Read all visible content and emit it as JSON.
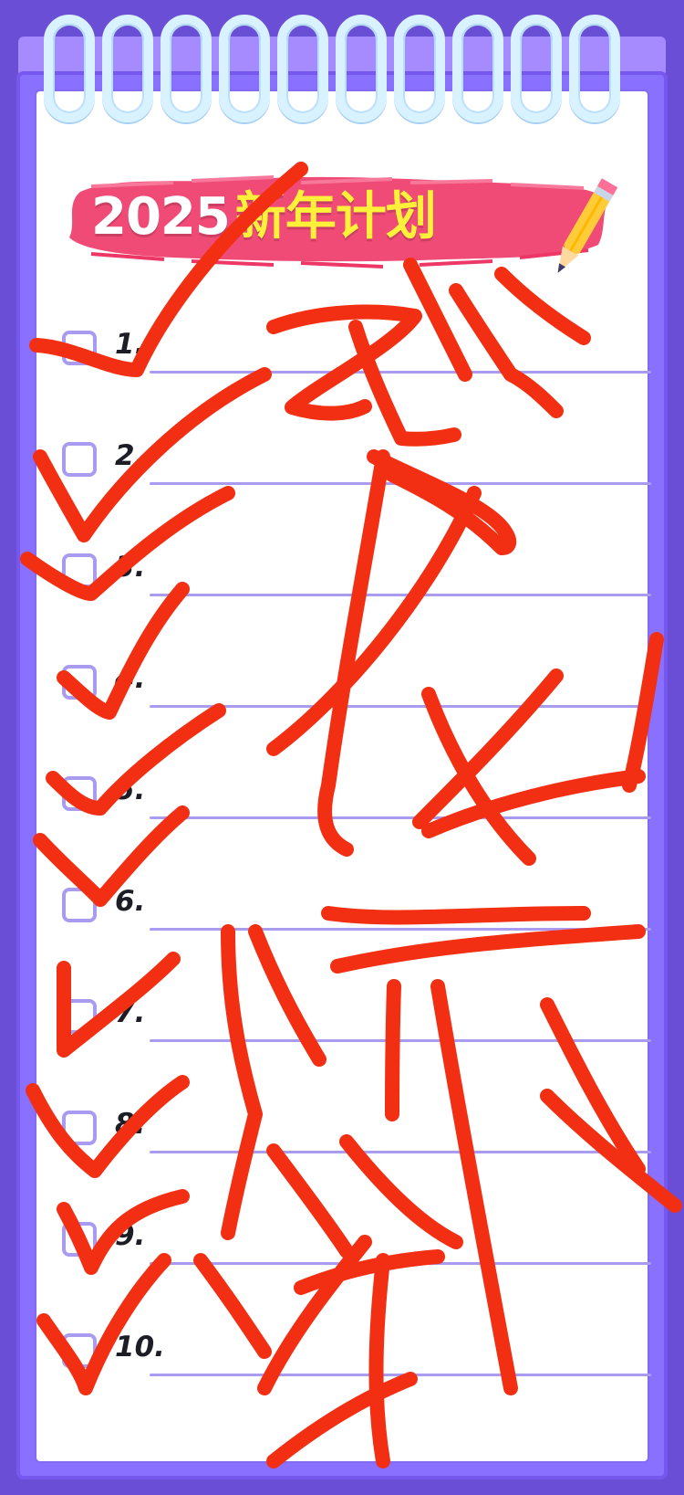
{
  "title": {
    "year": "2025",
    "plan_text": "新年计划"
  },
  "items": [
    {
      "number": "1."
    },
    {
      "number": "2."
    },
    {
      "number": "3."
    },
    {
      "number": "4."
    },
    {
      "number": "5."
    },
    {
      "number": "6."
    },
    {
      "number": "7."
    },
    {
      "number": "8."
    },
    {
      "number": "9."
    },
    {
      "number": "10."
    }
  ],
  "icons": {
    "rings": "spiral-ring-icon",
    "pencil": "pencil-icon",
    "checkbox": "checkbox-icon"
  },
  "colors": {
    "background": "#6a4fd6",
    "notebook_border": "#8a70ff",
    "paper": "#ffffff",
    "banner": "#f04b76",
    "title_year": "#ffffff",
    "title_plan": "#fff13a",
    "checkbox": "#a99cf0",
    "rule_line": "#a99cf0",
    "scribble": "#f32f13"
  }
}
